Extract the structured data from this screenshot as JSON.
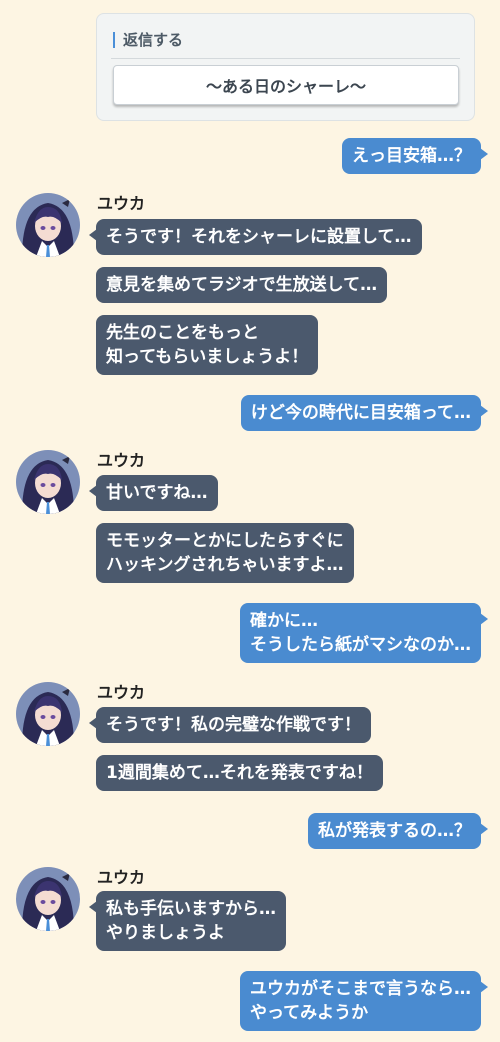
{
  "reply": {
    "title": "返信する",
    "option": "〜ある日のシャーレ〜"
  },
  "npc_name": "ユウカ",
  "messages": {
    "m1": "えっ目安箱…？",
    "m2": "そうです！それをシャーレに設置して…",
    "m3": "意見を集めてラジオで生放送して…",
    "m4": [
      "先生のことをもっと",
      "知ってもらいましょうよ！"
    ],
    "m5": "けど今の時代に目安箱って…",
    "m6": "甘いですね…",
    "m7": [
      "モモッターとかにしたらすぐに",
      "ハッキングされちゃいますよ…"
    ],
    "m8": [
      "確かに…",
      "そうしたら紙がマシなのか…"
    ],
    "m9": "そうです！私の完璧な作戦です！",
    "m10": "1週間集めて…それを発表ですね！",
    "m11": "私が発表するの…？",
    "m12": [
      "私も手伝いますから…",
      "やりましょうよ"
    ],
    "m13": [
      "ユウカがそこまで言うなら…",
      "やってみようか"
    ]
  },
  "colors": {
    "background": "#fdf5e3",
    "npc_bubble": "#4b596d",
    "player_bubble": "#4a8bd0",
    "accent": "#4a8fd8"
  }
}
